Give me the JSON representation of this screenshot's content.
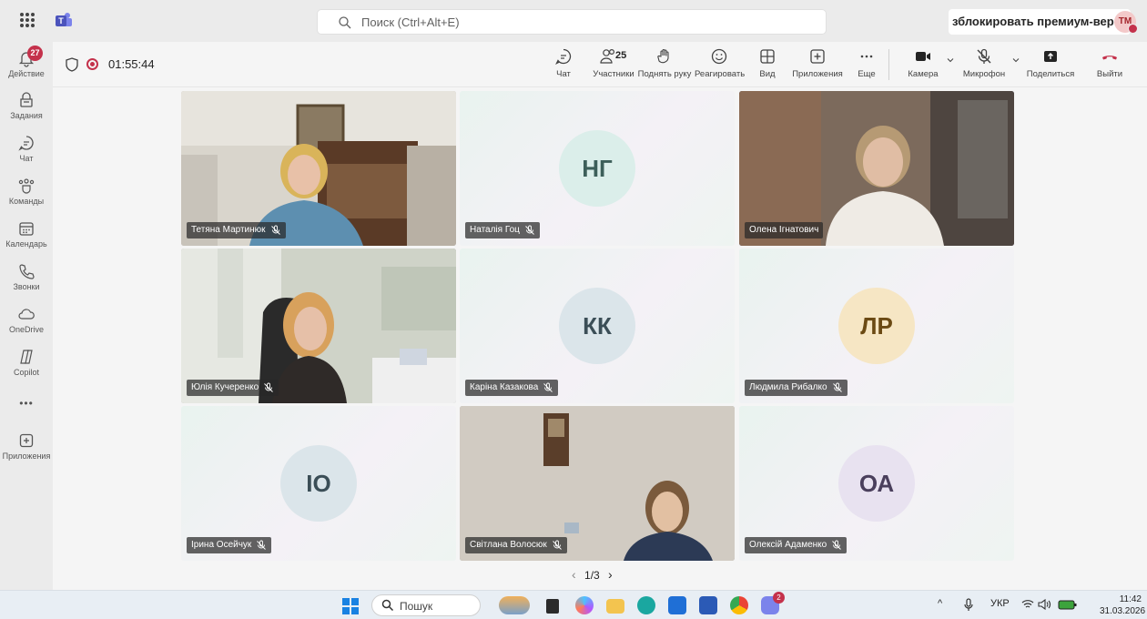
{
  "titlebar": {
    "search_placeholder": "Поиск (Ctrl+Alt+E)",
    "premium_text": "зблокировать премиум-версию",
    "user_initials": "TM"
  },
  "rail": {
    "activity": {
      "label": "Действие",
      "badge": "27"
    },
    "items": [
      {
        "label": "Задания",
        "icon": "assignments-icon"
      },
      {
        "label": "Чат",
        "icon": "chat-icon"
      },
      {
        "label": "Команды",
        "icon": "teams-icon"
      },
      {
        "label": "Календарь",
        "icon": "calendar-icon"
      },
      {
        "label": "Звонки",
        "icon": "calls-icon"
      },
      {
        "label": "OneDrive",
        "icon": "onedrive-icon"
      },
      {
        "label": "Copilot",
        "icon": "copilot-icon"
      }
    ],
    "more": "•••",
    "apps_label": "Приложения"
  },
  "toolbar": {
    "timer": "01:55:44",
    "participants_count": "25",
    "chat": "Чат",
    "participants": "Участники",
    "raise_hand": "Поднять руку",
    "react": "Реагировать",
    "view": "Вид",
    "apps": "Приложения",
    "more": "Еще",
    "camera": "Камера",
    "mic": "Микрофон",
    "share": "Поделиться",
    "leave": "Выйти"
  },
  "colors": {
    "accent": "#5b5fc7",
    "leave": "#c4314b"
  },
  "participants": [
    {
      "name": "Тетяна Мартинюк",
      "type": "video",
      "scene": "office-blonde"
    },
    {
      "name": "Наталія Гоц",
      "type": "avatar",
      "initials": "НГ",
      "avatar_bg": "#dbeeea",
      "avatar_fg": "#3d5f5a"
    },
    {
      "name": "Олена Ігнатович",
      "type": "video",
      "scene": "room-white",
      "active": true
    },
    {
      "name": "Юлія Кучеренко",
      "type": "video",
      "scene": "office-redhead"
    },
    {
      "name": "Каріна Казакова",
      "type": "avatar",
      "initials": "КК",
      "avatar_bg": "#dbe5ea",
      "avatar_fg": "#3b4e57"
    },
    {
      "name": "Людмила Рибалко",
      "type": "avatar",
      "initials": "ЛР",
      "avatar_bg": "#f6e6c4",
      "avatar_fg": "#6b4a14"
    },
    {
      "name": "Ірина Осейчук",
      "type": "avatar",
      "initials": "ІО",
      "avatar_bg": "#dbe5ea",
      "avatar_fg": "#3b4e57"
    },
    {
      "name": "Світлана Волосюк",
      "type": "video",
      "scene": "wallpaper-room"
    },
    {
      "name": "Олексій Адаменко",
      "type": "avatar",
      "initials": "ОА",
      "avatar_bg": "#e8e2f0",
      "avatar_fg": "#4a3f5c"
    }
  ],
  "pager": {
    "label": "1/3"
  },
  "taskbar": {
    "search_placeholder": "Пошук",
    "lang": "УКР",
    "time": "11:42",
    "date": "31.03.2026",
    "notification_badge": "2"
  }
}
